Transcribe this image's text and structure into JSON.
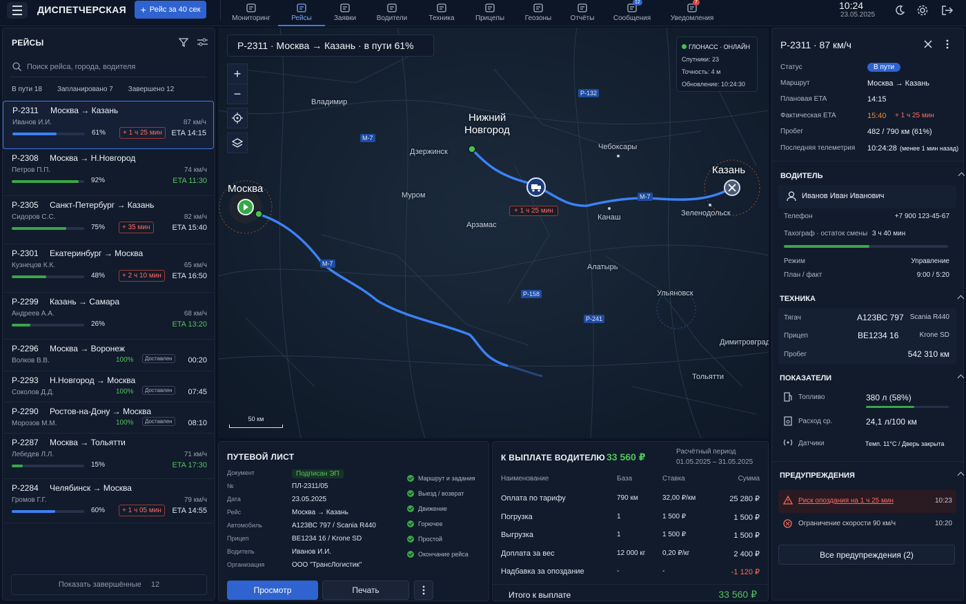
{
  "topbar": {
    "brand": "ДИСПЕТЧЕРСКАЯ",
    "new_trip_label": "Рейс за 40 сек",
    "nav": [
      {
        "label": "Мониторинг",
        "icon": "monitor-icon",
        "badge": ""
      },
      {
        "label": "Рейсы",
        "icon": "trips-icon",
        "badge": ""
      },
      {
        "label": "Заявки",
        "icon": "orders-icon",
        "badge": ""
      },
      {
        "label": "Водители",
        "icon": "drivers-icon",
        "badge": ""
      },
      {
        "label": "Техника",
        "icon": "truck-icon",
        "badge": ""
      },
      {
        "label": "Прицепы",
        "icon": "trailer-icon",
        "badge": ""
      },
      {
        "label": "Геозоны",
        "icon": "geozone-icon",
        "badge": ""
      },
      {
        "label": "Отчёты",
        "icon": "reports-icon",
        "badge": ""
      },
      {
        "label": "Сообщения",
        "icon": "mail-icon",
        "badge": "12"
      },
      {
        "label": "Уведомления",
        "icon": "bell-icon",
        "badge": "7"
      }
    ],
    "time": "10:24",
    "date": "23.05.2025"
  },
  "trips_panel": {
    "title": "РЕЙСЫ",
    "search_placeholder": "Поиск рейса, города, водителя",
    "tabs": [
      "В пути 18",
      "Запланировано 7",
      "Завершено 12"
    ],
    "trips": [
      {
        "id": "Р-2311",
        "route": "Москва → Казань",
        "driver": "Иванов И.И.",
        "speed": "87 км/ч",
        "progress": 61,
        "pct": "61%",
        "delay": "+ 1 ч 25 мин",
        "eta": "ETA 14:15",
        "status": "active"
      },
      {
        "id": "Р-2308",
        "route": "Москва → Н.Новгород",
        "driver": "Петров П.П.",
        "speed": "74 км/ч",
        "progress": 92,
        "pct": "92%",
        "delay": "",
        "eta": "ETA 11:30",
        "status": "active"
      },
      {
        "id": "Р-2305",
        "route": "Санкт-Петербург → Казань",
        "driver": "Сидоров С.С.",
        "speed": "82 км/ч",
        "progress": 75,
        "pct": "75%",
        "delay": "+ 35 мин",
        "eta": "ETA 15:40",
        "status": "active"
      },
      {
        "id": "Р-2301",
        "route": "Екатеринбург → Москва",
        "driver": "Кузнецов К.К.",
        "speed": "65 км/ч",
        "progress": 48,
        "pct": "48%",
        "delay": "+ 2 ч 10 мин",
        "eta": "ETA 16:50",
        "status": "active"
      },
      {
        "id": "Р-2299",
        "route": "Казань → Самара",
        "driver": "Андреев А.А.",
        "speed": "68 км/ч",
        "progress": 26,
        "pct": "26%",
        "delay": "",
        "eta": "ETA 13:20",
        "status": "active"
      },
      {
        "id": "Р-2296",
        "route": "Москва → Воронеж",
        "driver": "Волков В.В.",
        "pct": "100%",
        "delivered": "Доставлен",
        "time": "00:20",
        "status": "done"
      },
      {
        "id": "Р-2293",
        "route": "Н.Новгород → Москва",
        "driver": "Соколов Д.Д.",
        "pct": "100%",
        "delivered": "Доставлен",
        "time": "07:45",
        "status": "done"
      },
      {
        "id": "Р-2290",
        "route": "Ростов-на-Дону → Москва",
        "driver": "Морозов М.М.",
        "pct": "100%",
        "delivered": "Доставлен",
        "time": "08:10",
        "status": "done"
      },
      {
        "id": "Р-2287",
        "route": "Москва → Тольятти",
        "driver": "Лебедев Л.Л.",
        "speed": "71 км/ч",
        "progress": 15,
        "pct": "15%",
        "delay": "",
        "eta": "ETA 17:30",
        "status": "active"
      },
      {
        "id": "Р-2284",
        "route": "Челябинск → Москва",
        "driver": "Громов Г.Г.",
        "speed": "79 км/ч",
        "progress": 60,
        "pct": "60%",
        "delay": "+ 1 ч 05 мин",
        "eta": "ETA 14:55",
        "status": "active"
      }
    ],
    "show_done_label": "Показать завершённые",
    "show_done_count": "12"
  },
  "map": {
    "banner": "Р-2311 · Москва → Казань · в пути 61%",
    "glonass": {
      "title": "ГЛОНАСС · ОНЛАЙН",
      "satellites": "Спутники: 23",
      "accuracy": "Точность: 4 м",
      "updated": "Обновление: 10:24:30"
    },
    "cities_big": [
      "Москва",
      "Нижний",
      "Новгород",
      "Казань"
    ],
    "cities": [
      "Владимир",
      "Дзержинск",
      "Чебоксары",
      "Муром",
      "Арзамас",
      "Канаш",
      "Зеленодольск",
      "Алатырь",
      "Ульяновск",
      "Димитровград",
      "Тольятти"
    ],
    "roads": [
      "М-7",
      "Р-132",
      "М-7",
      "М-7",
      "Р-158",
      "Р-241"
    ],
    "delay_tag": "+ 1 ч 25 мин",
    "scale": "50 км"
  },
  "waybill": {
    "title": "ПУТЕВОЙ ЛИСТ",
    "rows": [
      {
        "k": "Документ",
        "v": "Подписан ЭП"
      },
      {
        "k": "№",
        "v": "ПЛ-2311/05"
      },
      {
        "k": "Дата",
        "v": "23.05.2025"
      },
      {
        "k": "Рейс",
        "v": "Москва → Казань"
      },
      {
        "k": "Автомобиль",
        "v": "А123ВС 797  /  Scania R440"
      },
      {
        "k": "Прицеп",
        "v": "ВЕ1234 16  /  Krone SD"
      },
      {
        "k": "Водитель",
        "v": "Иванов И.И."
      },
      {
        "k": "Организация",
        "v": "ООО \"ТрансЛогистик\""
      }
    ],
    "checks": [
      "Маршрут и задания",
      "Выезд / возврат",
      "Движение",
      "Горючее",
      "Простой",
      "Окончание рейса"
    ],
    "view_label": "Просмотр",
    "print_label": "Печать"
  },
  "payment": {
    "title": "К ВЫПЛАТЕ ВОДИТЕЛЮ",
    "amount": "33 560 ₽",
    "period_label": "Расчётный период",
    "period": "01.05.2025 – 31.05.2025",
    "headers": [
      "Наименование",
      "База",
      "Ставка",
      "Сумма"
    ],
    "rows": [
      {
        "name": "Оплата по тарифу",
        "base": "790 км",
        "rate": "32,00 ₽/км",
        "sum": "25 280 ₽"
      },
      {
        "name": "Погрузка",
        "base": "1",
        "rate": "1 500 ₽",
        "sum": "1 500 ₽"
      },
      {
        "name": "Выгрузка",
        "base": "1",
        "rate": "1 500 ₽",
        "sum": "1 500 ₽"
      },
      {
        "name": "Доплата за вес",
        "base": "12 000 кг",
        "rate": "0,20 ₽/кг",
        "sum": "2 400 ₽"
      },
      {
        "name": "Надбавка за опоздание",
        "base": "-",
        "rate": "-",
        "sum": "-1 120 ₽"
      }
    ],
    "total_label": "Итого к выплате",
    "total": "33 560 ₽"
  },
  "details": {
    "title": "Р-2311 · 87 км/ч",
    "status_label": "Статус",
    "status": "В пути",
    "route_label": "Маршрут",
    "route": "Москва → Казань",
    "plan_eta_label": "Плановая ETA",
    "plan_eta": "14:15",
    "fact_eta_label": "Фактическая ETA",
    "fact_eta": "15:40",
    "fact_delay": "+ 1 ч 25 мин",
    "mileage_label": "Пробег",
    "mileage": "482 / 790 км (61%)",
    "telemetry_label": "Последняя телеметрия",
    "telemetry": "10:24:28",
    "telemetry_note": "(менее 1 мин назад)",
    "driver_section": "ВОДИТЕЛЬ",
    "driver_name": "Иванов Иван Иванович",
    "phone_label": "Телефон",
    "phone": "+7 900 123-45-67",
    "tacho_label": "Тахограф · остаток смены",
    "tacho": "3 ч 40 мин",
    "tacho_progress": 0.52,
    "mode_label": "Режим",
    "mode": "Управление",
    "planfact_label": "План / факт",
    "planfact": "9:00 / 5:20",
    "vehicle_section": "ТЕХНИКА",
    "tractor_label": "Тягач",
    "tractor": "А123ВС 797",
    "tractor_model": "Scania R440",
    "trailer_label": "Прицеп",
    "trailer": "ВЕ1234  16",
    "trailer_model": "Krone SD",
    "odometer_label": "Пробег",
    "odometer": "542  310 км",
    "metrics_section": "ПОКАЗАТЕЛИ",
    "fuel_label": "Топливо",
    "fuel": "380 л    (58%)",
    "fuel_progress": 0.58,
    "consumption_label": "Расход ср.",
    "consumption": "24,1 л/100 км",
    "sensors_label": "Датчики",
    "sensors": "Темп. 11°C  /  Дверь закрыта",
    "warnings_section": "ПРЕДУПРЕЖДЕНИЯ",
    "warnings": [
      {
        "text": "Риск опоздания на 1 ч 25 мин",
        "time": "10:23"
      },
      {
        "text": "Ограничение скорости 90 км/ч",
        "time": "10:20"
      }
    ],
    "all_warnings_label": "Все предупреждения (2)"
  },
  "colors": {
    "accent": "#2f63d0",
    "route": "#3b82f6",
    "danger": "#ff6b5e",
    "ok": "#53c35b"
  }
}
